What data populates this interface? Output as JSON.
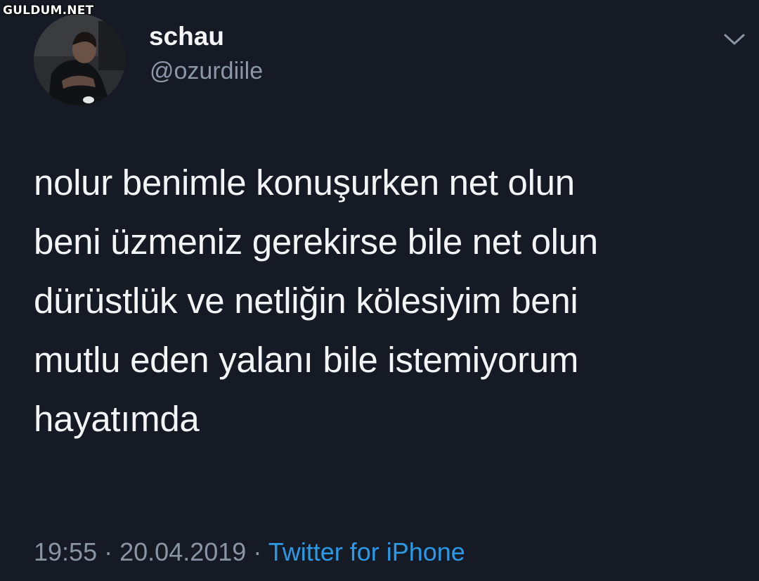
{
  "watermark": "GULDUM.NET",
  "tweet": {
    "display_name": "schau",
    "handle": "@ozurdiile",
    "text_lines": [
      "nolur benimle konuşurken net olun",
      "beni üzmeniz gerekirse bile net olun",
      "dürüstlük ve netliğin kölesiyim beni",
      "mutlu eden yalanı bile istemiyorum",
      "hayatımda"
    ],
    "time": "19:55",
    "separator": "·",
    "date": "20.04.2019",
    "source": "Twitter for iPhone"
  },
  "icons": {
    "menu": "chevron-down-icon"
  },
  "colors": {
    "background": "#151a24",
    "text": "#f2f4f6",
    "muted": "#8a95a3",
    "link": "#2a9ae6"
  }
}
